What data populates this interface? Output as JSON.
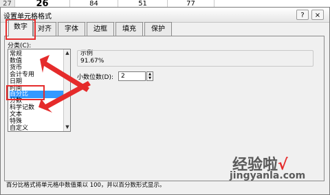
{
  "sheet": {
    "row_number": "27",
    "cells": [
      "26",
      "84",
      "51",
      "77"
    ]
  },
  "dialog": {
    "title": "设置单元格格式",
    "help_label": "?",
    "close_label": "×",
    "tabs": [
      "数字",
      "对齐",
      "字体",
      "边框",
      "填充",
      "保护"
    ],
    "category_label": "分类(C):",
    "categories": [
      "常规",
      "数值",
      "货币",
      "会计专用",
      "日期",
      "时间",
      "百分比",
      "分数",
      "科学记数",
      "文本",
      "特殊",
      "自定义"
    ],
    "selected_category": "百分比",
    "sample_label": "示例",
    "sample_value": "91.67%",
    "decimal_label": "小数位数(D):",
    "decimal_value": "2",
    "description": "百分比格式将单元格中数值乘以 100，并以百分数形式显示。"
  },
  "watermark": {
    "brand": "经验啦",
    "check": "√",
    "domain": "jingyanla.com"
  },
  "colors": {
    "highlight_red": "#e52b2b",
    "selection_blue": "#3399ff"
  }
}
